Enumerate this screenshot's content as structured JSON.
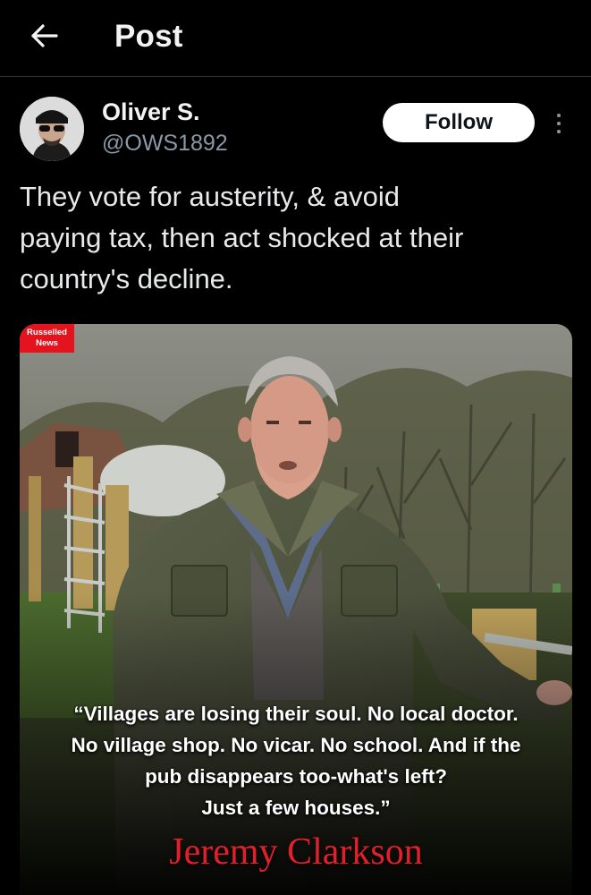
{
  "header": {
    "title": "Post",
    "back_icon": "arrow-left-icon"
  },
  "author": {
    "display_name": "Oliver S.",
    "handle": "@OWS1892",
    "follow_label": "Follow",
    "more_icon": "more-vertical-icon"
  },
  "post": {
    "lines": [
      "They vote for austerity, & avoid",
      "paying tax, then act shocked at their",
      "country's decline."
    ]
  },
  "media": {
    "badge": [
      "Russelled",
      "News"
    ],
    "quote_lines": [
      "“Villages are losing their soul. No local doctor.",
      "No village shop. No vicar. No school. And if the",
      "pub disappears too-what's left?",
      "Just a few houses.”"
    ],
    "quote_author": "Jeremy Clarkson"
  },
  "colors": {
    "background": "#000000",
    "follow_button": "#ffffff",
    "handle": "#8b98a5",
    "badge": "#e4141e",
    "quote_author": "#e3202a"
  }
}
